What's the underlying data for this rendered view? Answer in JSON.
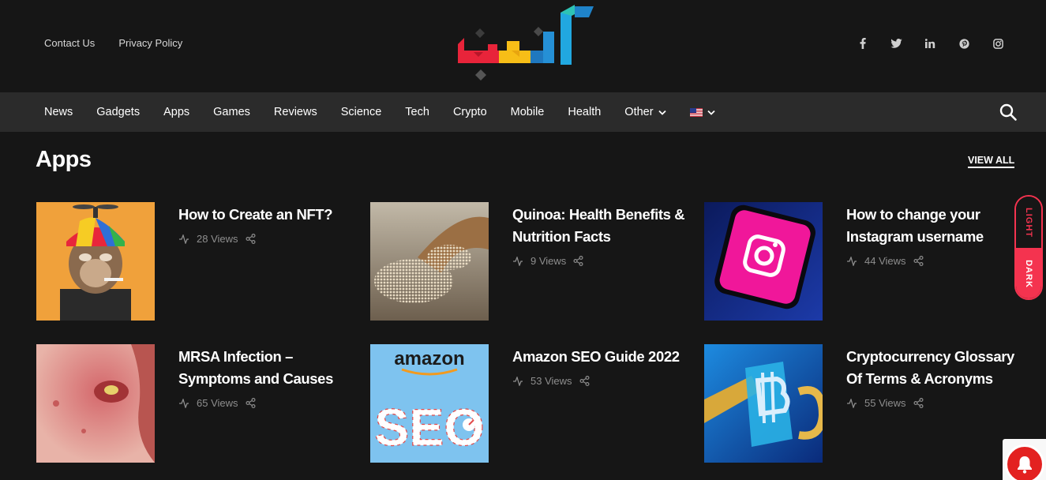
{
  "top_links": [
    "Contact Us",
    "Privacy Policy"
  ],
  "social": [
    "facebook-icon",
    "twitter-icon",
    "linkedin-icon",
    "pinterest-icon",
    "instagram-icon"
  ],
  "nav": {
    "items": [
      "News",
      "Gadgets",
      "Apps",
      "Games",
      "Reviews",
      "Science",
      "Tech",
      "Crypto",
      "Mobile",
      "Health"
    ],
    "other_label": "Other"
  },
  "section": {
    "title": "Apps",
    "view_all": "VIEW ALL"
  },
  "posts": [
    {
      "title": "How to Create an NFT?",
      "views": "28 Views"
    },
    {
      "title": "Quinoa: Health Benefits & Nutrition Facts",
      "views": "9 Views"
    },
    {
      "title": "How to change your Instagram username",
      "views": "44 Views"
    },
    {
      "title": "MRSA Infection – Symptoms and Causes",
      "views": "65 Views"
    },
    {
      "title": "Amazon SEO Guide 2022",
      "views": "53 Views"
    },
    {
      "title": "Cryptocurrency Glossary Of Terms & Acronyms",
      "views": "55 Views"
    }
  ],
  "thumb_text": {
    "amazon": "amazon",
    "seo": "SEO"
  },
  "mode": {
    "light": "LIGHT",
    "dark": "DARK"
  },
  "colors": {
    "accent": "#f4334f",
    "background": "#161616",
    "nav_background": "#2b2b2b"
  }
}
